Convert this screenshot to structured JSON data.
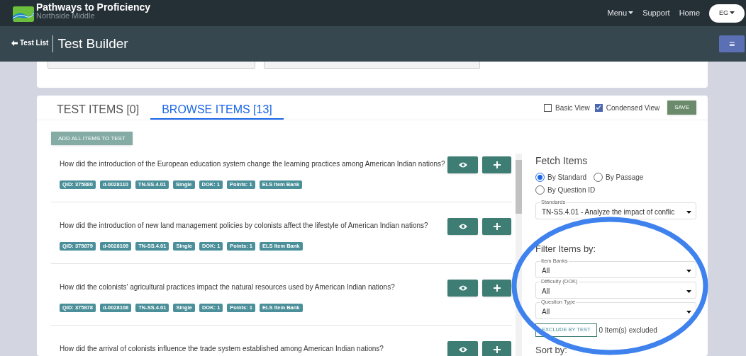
{
  "navbar": {
    "title": "Pathways to Proficiency",
    "subtitle": "Northside Middle",
    "links": [
      {
        "label": "Menu",
        "kind": "dropdown"
      },
      {
        "label": "Support",
        "kind": "link"
      },
      {
        "label": "Home",
        "kind": "link"
      }
    ],
    "user": "EG"
  },
  "toolbar": {
    "back": "Test List",
    "title": "Test Builder",
    "menu_icon": "≡"
  },
  "tabs": [
    {
      "label": "TEST ITEMS [0]",
      "selected": false
    },
    {
      "label": "BROWSE ITEMS [13]",
      "selected": true
    }
  ],
  "view_options": [
    {
      "label": "Basic View",
      "checked": false
    },
    {
      "label": "Condensed View",
      "checked": true
    }
  ],
  "save_button": "SAVE",
  "add_all_button": "ADD ALL ITEMS TO TEST",
  "items": [
    {
      "question": "How did the introduction of the European education system change the learning practices among American Indian nations?",
      "tags": [
        "QID: 375880",
        "d-0028110",
        "TN-SS.4.01",
        "Single",
        "DOK: 1",
        "Points: 1",
        "ELS Item Bank"
      ]
    },
    {
      "question": "How did the introduction of new land management policies by colonists affect the lifestyle of American Indian nations?",
      "tags": [
        "QID: 375879",
        "d-0028109",
        "TN-SS.4.01",
        "Single",
        "DOK: 1",
        "Points: 1",
        "ELS Item Bank"
      ]
    },
    {
      "question": "How did the colonists' agricultural practices impact the natural resources used by American Indian nations?",
      "tags": [
        "QID: 375878",
        "d-0028108",
        "TN-SS.4.01",
        "Single",
        "DOK: 1",
        "Points: 1",
        "ELS Item Bank"
      ]
    },
    {
      "question": "How did the arrival of colonists influence the trade system established among American Indian nations?"
    }
  ],
  "fetch": {
    "heading": "Fetch Items",
    "options": [
      {
        "label": "By Standard",
        "selected": true
      },
      {
        "label": "By Passage",
        "selected": false
      },
      {
        "label": "By Question ID",
        "selected": false
      }
    ],
    "standards": {
      "label": "Standards",
      "value": "TN-SS.4.01 - Analyze the impact of conflic"
    }
  },
  "filter": {
    "heading": "Filter Items by:",
    "fields": [
      {
        "label": "Item Banks",
        "value": "All"
      },
      {
        "label": "Difficulty (DOK)",
        "value": "All"
      },
      {
        "label": "Question Type",
        "value": "All"
      }
    ],
    "exclude_button": "EXCLUDE BY TEST",
    "excluded": "0 Item(s) excluded"
  },
  "sort_heading": "Sort by:"
}
